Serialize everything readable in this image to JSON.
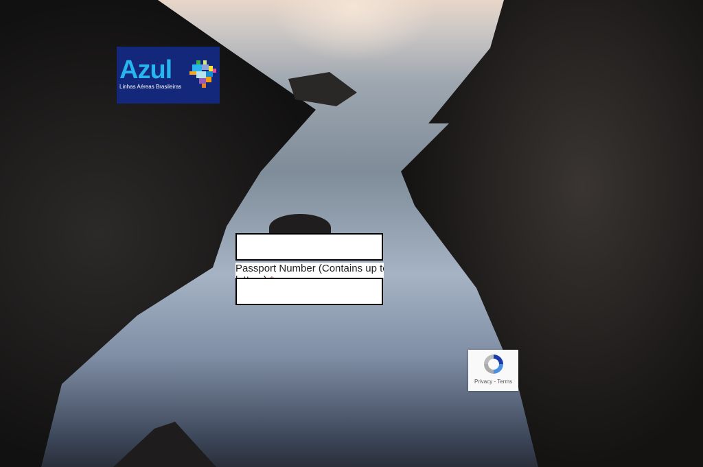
{
  "logo": {
    "brand": "Azul",
    "tagline": "Linhas Aéreas Brasileiras",
    "bg_color": "#13287a",
    "text_color": "#28b4ee"
  },
  "form": {
    "field1_value": "",
    "passport_label": "Passport Number (Contains up to",
    "passport_label_cont": "letters)",
    "required_mark": "*",
    "passport_value": ""
  },
  "recaptcha": {
    "icon": "recaptcha-icon",
    "privacy": "Privacy",
    "separator": " - ",
    "terms": "Terms"
  }
}
